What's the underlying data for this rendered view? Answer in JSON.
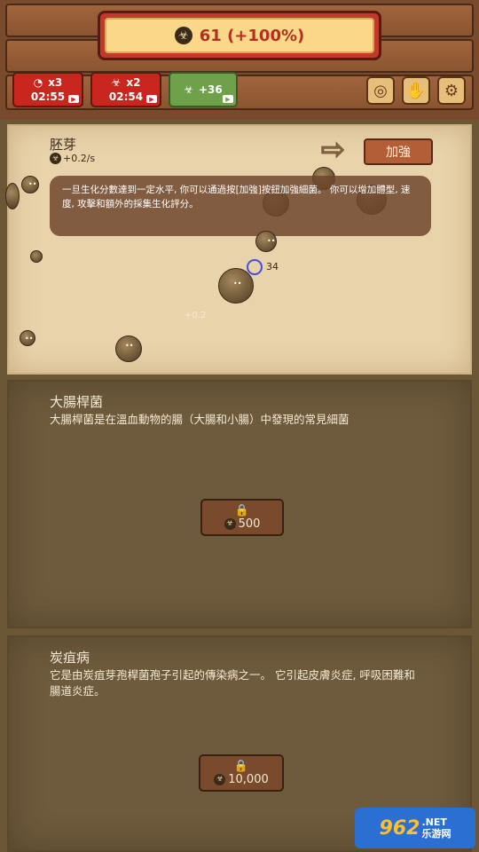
{
  "header": {
    "score": "61 (+100%)",
    "boosts": [
      {
        "name": "speed",
        "multiplier": "x3",
        "timer": "02:55",
        "color": "#c9261d"
      },
      {
        "name": "biohazard",
        "multiplier": "x2",
        "timer": "02:54",
        "color": "#c9261d"
      },
      {
        "name": "bonus",
        "amount": "+36",
        "color": "#6fa04a"
      }
    ]
  },
  "stage": {
    "title": "胚芽",
    "rate": "+0.2/s",
    "upgrade_label": "加強",
    "tip": "一旦生化分數達到一定水平, 你可以通過按[加強]按鈕加強細菌。 你可以增加體型, 速度, 攻擊和額外的採集生化評分。",
    "target_value": "34",
    "float_text": "+0.2"
  },
  "locked": [
    {
      "title": "大腸桿菌",
      "description": "大腸桿菌是在溫血動物的腸（大腸和小腸）中發現的常見細菌",
      "price": "500"
    },
    {
      "title": "炭疽病",
      "description": "它是由炭疽芽孢桿菌孢子引起的傳染病之一。 它引起皮膚炎症, 呼吸困難和腸道炎症。",
      "price": "10,000"
    }
  ],
  "watermark": {
    "logo": "962",
    "suffix": ".NET",
    "sub": "乐游网"
  }
}
